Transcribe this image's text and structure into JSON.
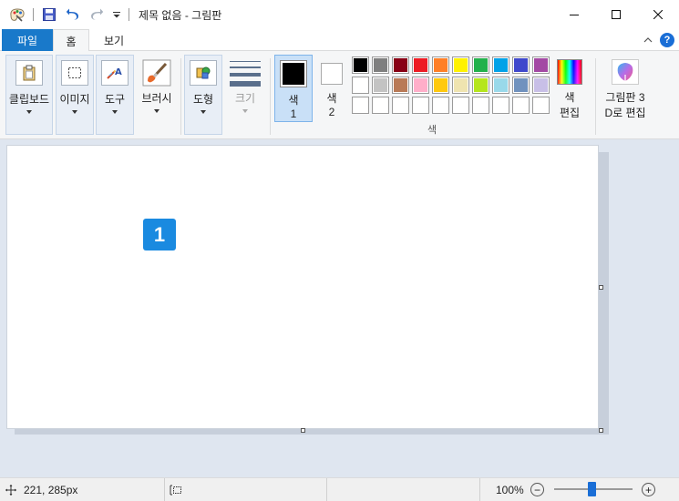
{
  "window": {
    "title": "제목 없음 - 그림판",
    "minimize_glyph": "—",
    "maximize_glyph": "☐",
    "close_glyph": "✕"
  },
  "quick_access": {
    "icons": [
      "paint-app-icon",
      "save-icon",
      "undo-icon",
      "redo-icon",
      "customize-dropdown-icon"
    ]
  },
  "tabs": {
    "file": "파일",
    "home": "홈",
    "view": "보기"
  },
  "ribbon": {
    "clipboard": "클립보드",
    "image": "이미지",
    "tools": "도구",
    "brushes": "브러시",
    "shapes": "도형",
    "size": "크기",
    "color1_line1": "색",
    "color1_line2": "1",
    "color2_line1": "색",
    "color2_line2": "2",
    "edit_colors_line1": "색",
    "edit_colors_line2": "편집",
    "paint3d_line1": "그림판 3",
    "paint3d_line2": "D로 편집",
    "colors_group": "색",
    "color1_value": "#000000",
    "color2_value": "#ffffff"
  },
  "palette": {
    "row1": [
      "#000000",
      "#7f7f7f",
      "#880015",
      "#ed1c24",
      "#ff7f27",
      "#fff200",
      "#22b14c",
      "#00a2e8",
      "#3f48cc",
      "#a349a4"
    ],
    "row2": [
      "#ffffff",
      "#c3c3c3",
      "#b97a57",
      "#ffaec9",
      "#ffc90e",
      "#efe4b0",
      "#b5e61d",
      "#99d9ea",
      "#7092be",
      "#c8bfe7"
    ],
    "row3": [
      "#ffffff",
      "#ffffff",
      "#ffffff",
      "#ffffff",
      "#ffffff",
      "#ffffff",
      "#ffffff",
      "#ffffff",
      "#ffffff",
      "#ffffff"
    ]
  },
  "canvas": {
    "badge_label": "1",
    "badge_color": "#1a8ae0"
  },
  "status": {
    "cursor_position": "221, 285px",
    "zoom": "100%",
    "zoom_out": "−",
    "zoom_in": "+"
  },
  "colors": {
    "accent": "#1979ca",
    "ribbon_bg": "#f5f6f7",
    "workspace_bg": "#dfe6f0"
  }
}
